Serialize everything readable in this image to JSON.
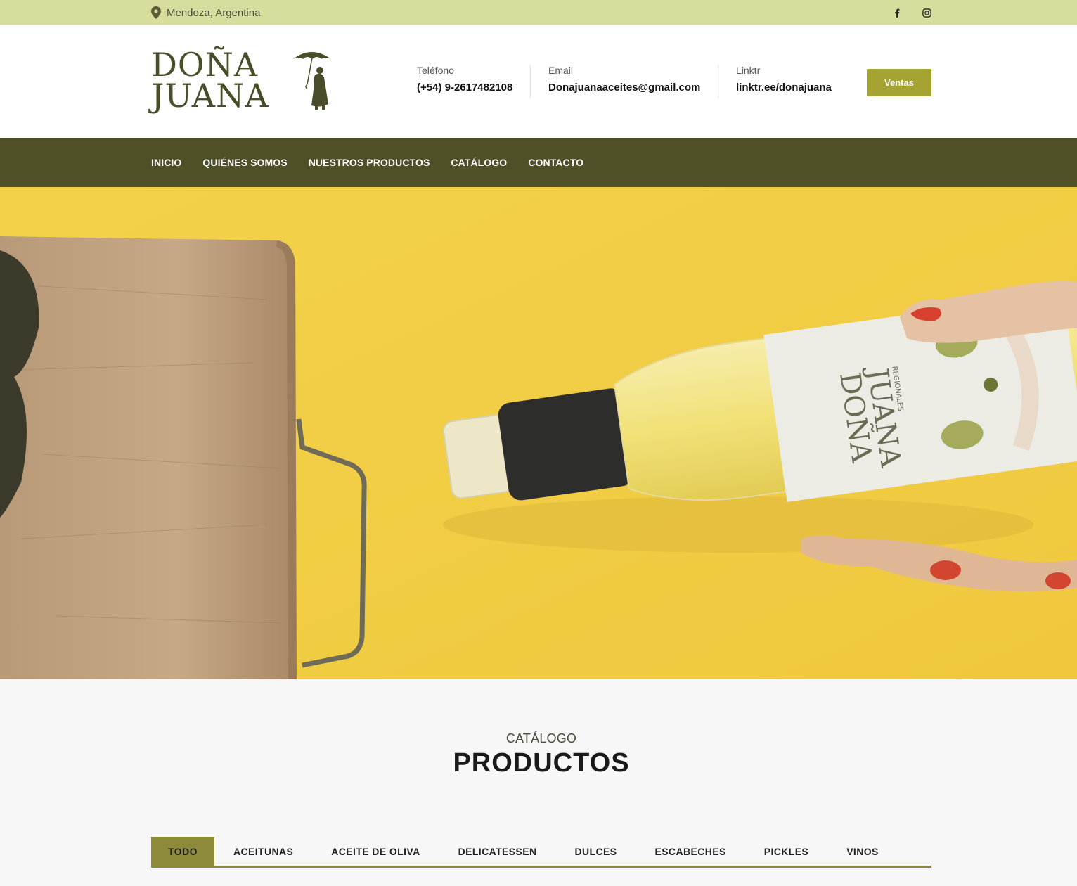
{
  "topbar": {
    "location": "Mendoza, Argentina",
    "location_icon": "map-pin-icon",
    "social": [
      "facebook-icon",
      "instagram-icon"
    ]
  },
  "header": {
    "logo_line1": "DOÑA",
    "logo_line2": "JUANA",
    "contacts": [
      {
        "label": "Teléfono",
        "value": "(+54) 9-2617482108"
      },
      {
        "label": "Email",
        "value": "Donajuanaaceites@gmail.com"
      },
      {
        "label": "Linktr",
        "value": "linktr.ee/donajuana"
      }
    ],
    "cta_label": "Ventas"
  },
  "nav": {
    "items": [
      "INICIO",
      "QUIÉNES SOMOS",
      "NUESTROS PRODUCTOS",
      "CATÁLOGO",
      "CONTACTO"
    ]
  },
  "hero": {
    "label_line1": "DOÑA",
    "label_line2": "JUANA",
    "label_sub": "REGIONALES"
  },
  "catalog": {
    "kicker": "CATÁLOGO",
    "title": "PRODUCTOS",
    "tabs": [
      "TODO",
      "ACEITUNAS",
      "ACEITE DE OLIVA",
      "DELICATESSEN",
      "DULCES",
      "ESCABECHES",
      "PICKLES",
      "VINOS"
    ],
    "active_tab": "TODO"
  },
  "colors": {
    "topbar": "#d7dd9c",
    "nav": "#4f5027",
    "accent": "#a5a332",
    "tab_active": "#8d8a3a"
  }
}
